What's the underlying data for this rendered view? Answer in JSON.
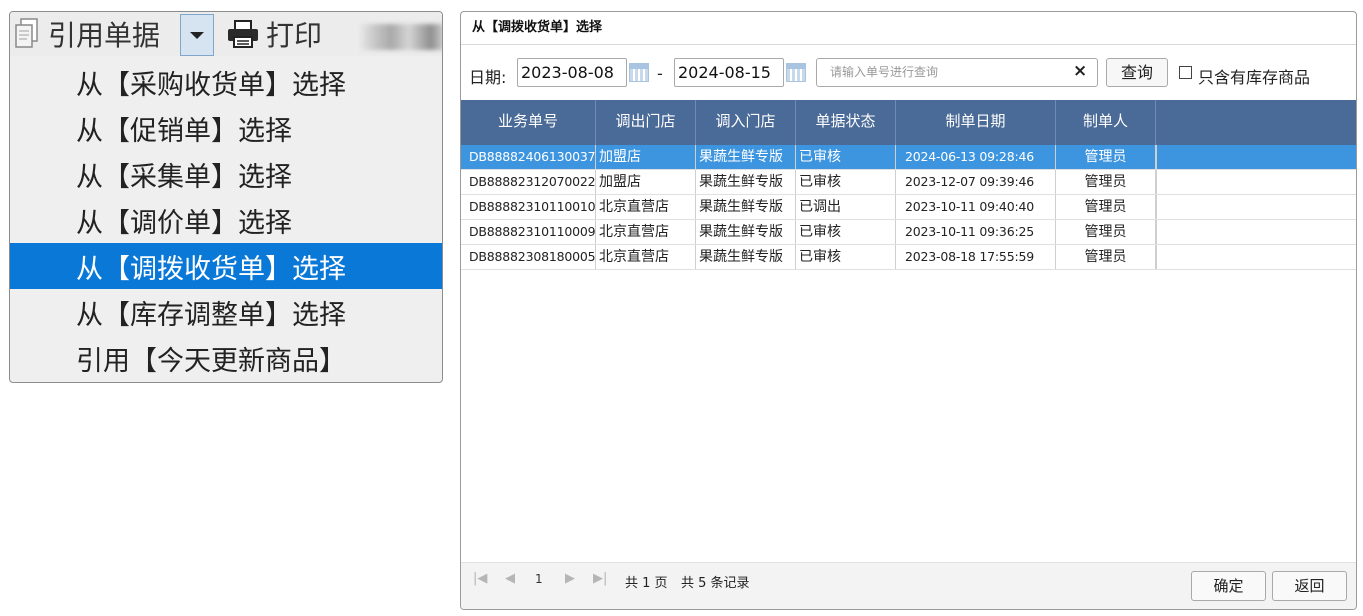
{
  "toolbar": {
    "cite_label": "引用单据",
    "print_label": "打印",
    "cite_icon": "document-copy-icon",
    "print_icon": "printer-icon",
    "dropdown_icon": "chevron-down-icon"
  },
  "menu": {
    "items": [
      {
        "label": "从【采购收货单】选择"
      },
      {
        "label": "从【促销单】选择"
      },
      {
        "label": "从【采集单】选择"
      },
      {
        "label": "从【调价单】选择"
      },
      {
        "label": "从【调拨收货单】选择",
        "selected": true
      },
      {
        "label": "从【库存调整单】选择"
      },
      {
        "label": "引用【今天更新商品】"
      }
    ]
  },
  "dialog": {
    "title": "从【调拨收货单】选择",
    "filter": {
      "date_label": "日期:",
      "date_from": "2023-08-08",
      "date_to": "2024-08-15",
      "dash": "-",
      "search_placeholder": "请输入单号进行查询",
      "clear": "×",
      "query_label": "查询",
      "stock_only_label": "只含有库存商品",
      "stock_only_checked": false
    },
    "table": {
      "headers": [
        "业务单号",
        "调出门店",
        "调入门店",
        "单据状态",
        "制单日期",
        "制单人"
      ],
      "rows": [
        {
          "id": "DB88882406130037",
          "from": "加盟店",
          "to": "果蔬生鲜专版",
          "status": "已审核",
          "date": "2024-06-13 09:28:46",
          "creator": "管理员",
          "selected": true
        },
        {
          "id": "DB88882312070022",
          "from": "加盟店",
          "to": "果蔬生鲜专版",
          "status": "已审核",
          "date": "2023-12-07 09:39:46",
          "creator": "管理员"
        },
        {
          "id": "DB88882310110010",
          "from": "北京直营店",
          "to": "果蔬生鲜专版",
          "status": "已调出",
          "date": "2023-10-11 09:40:40",
          "creator": "管理员"
        },
        {
          "id": "DB88882310110009",
          "from": "北京直营店",
          "to": "果蔬生鲜专版",
          "status": "已审核",
          "date": "2023-10-11 09:36:25",
          "creator": "管理员"
        },
        {
          "id": "DB88882308180005",
          "from": "北京直营店",
          "to": "果蔬生鲜专版",
          "status": "已审核",
          "date": "2023-08-18 17:55:59",
          "creator": "管理员"
        }
      ]
    },
    "pager": {
      "current_page": "1",
      "total_pages_text": "共 1 页",
      "total_records_text": "共 5 条记录"
    },
    "buttons": {
      "ok_label": "确定",
      "back_label": "返回"
    },
    "colors": {
      "header_bg": "#4a6a97",
      "selected_row_bg": "#3d95e0",
      "menu_selected_bg": "#0a78d7"
    }
  }
}
